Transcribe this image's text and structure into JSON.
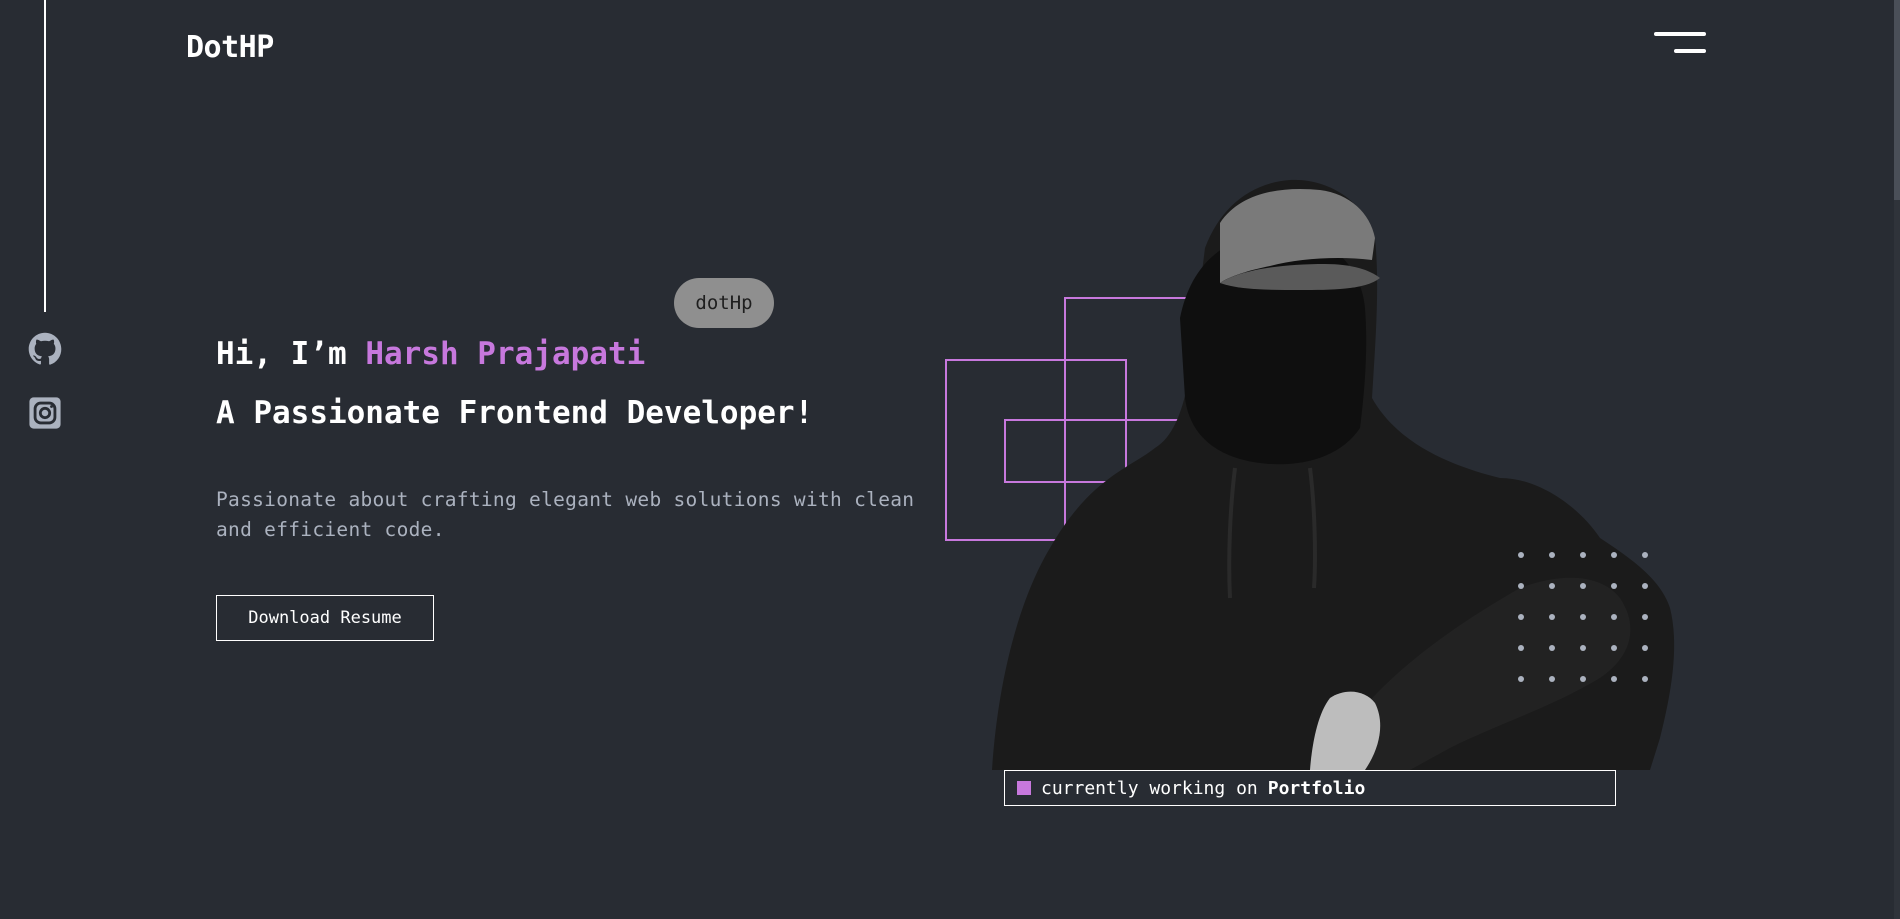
{
  "header": {
    "logo": "DotHP",
    "menu_icon": "hamburger-menu-icon"
  },
  "social": [
    {
      "name": "GitHub",
      "icon": "github-icon"
    },
    {
      "name": "Instagram",
      "icon": "instagram-icon"
    }
  ],
  "hero": {
    "badge": "dotHp",
    "greeting_prefix": "Hi, I’m ",
    "name": "Harsh Prajapati",
    "headline": "A Passionate Frontend Developer!",
    "description": "Passionate about crafting elegant web solutions with clean and efficient code.",
    "resume_button": "Download Resume",
    "status_prefix": "currently working on",
    "status_project": "Portfolio"
  },
  "colors": {
    "background": "#282c33",
    "accent": "#c778dd",
    "text": "#ffffff",
    "muted": "#abb2bf"
  }
}
